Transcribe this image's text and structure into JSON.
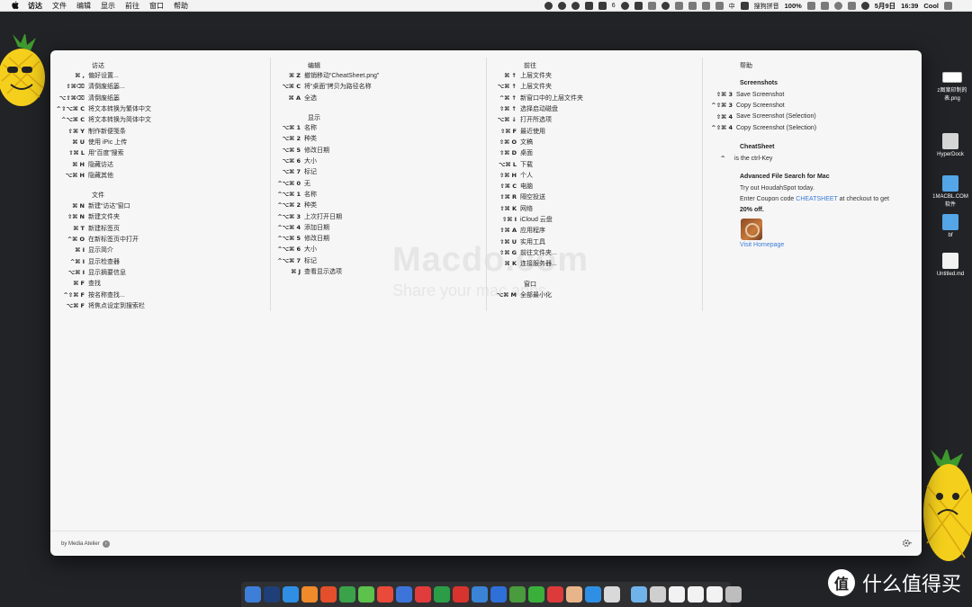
{
  "menubar": {
    "apple_icon": "apple-icon",
    "items": [
      "访达",
      "文件",
      "编辑",
      "显示",
      "前往",
      "窗口",
      "帮助"
    ],
    "status": {
      "battery_percent": "100%",
      "input_method": "搜狗拼音",
      "language": "中",
      "date": "5月9日",
      "time": "16:39",
      "user": "Cool",
      "badge_count": "6"
    }
  },
  "finder": {
    "title": "访达",
    "rows": [
      {
        "key": "⌘ ,",
        "label": "偏好设置..."
      },
      {
        "key": "⇧⌘⌫",
        "label": "清倒废纸篓..."
      },
      {
        "key": "⌥⇧⌘⌫",
        "label": "清倒废纸篓"
      },
      {
        "key": "^⇧⌥⌘ C",
        "label": "将文本转换为繁体中文"
      },
      {
        "key": "^⌥⌘ C",
        "label": "将文本转换为简体中文"
      },
      {
        "key": "⇧⌘ Y",
        "label": "制作新便笺条"
      },
      {
        "key": "⌘ U",
        "label": "使用 iPic 上传"
      },
      {
        "key": "⇧⌘ L",
        "label": "用“百度”搜索"
      },
      {
        "key": "⌘ H",
        "label": "隐藏访达"
      },
      {
        "key": "⌥⌘ H",
        "label": "隐藏其他"
      }
    ]
  },
  "file": {
    "title": "文件",
    "rows": [
      {
        "key": "⌘ N",
        "label": "新建“访达”窗口"
      },
      {
        "key": "⇧⌘ N",
        "label": "新建文件夹"
      },
      {
        "key": "⌘ T",
        "label": "新建标签页"
      },
      {
        "key": "^⌘ O",
        "label": "在新标签页中打开"
      },
      {
        "key": "⌘ I",
        "label": "显示简介"
      },
      {
        "key": "^⌘ I",
        "label": "显示检查器"
      },
      {
        "key": "⌥⌘ I",
        "label": "显示摘要信息"
      },
      {
        "key": "⌘ F",
        "label": "查找"
      },
      {
        "key": "^⇧⌘ F",
        "label": "按名称查找..."
      },
      {
        "key": "⌥⌘ F",
        "label": "将焦点设定到搜索栏"
      }
    ]
  },
  "edit": {
    "title": "编辑",
    "rows": [
      {
        "key": "⌘ Z",
        "label": "撤销移动“CheatSheet.png”"
      },
      {
        "key": "⌥⌘ C",
        "label": "将“桌面”拷贝为路径名称"
      },
      {
        "key": "⌘ A",
        "label": "全选"
      }
    ]
  },
  "view": {
    "title": "显示",
    "rows": [
      {
        "key": "⌥⌘ 1",
        "label": "名称"
      },
      {
        "key": "⌥⌘ 2",
        "label": "种类"
      },
      {
        "key": "⌥⌘ 5",
        "label": "修改日期"
      },
      {
        "key": "⌥⌘ 6",
        "label": "大小"
      },
      {
        "key": "⌥⌘ 7",
        "label": "标记"
      },
      {
        "key": "^⌥⌘ 0",
        "label": "无"
      },
      {
        "key": "^⌥⌘ 1",
        "label": "名称"
      },
      {
        "key": "^⌥⌘ 2",
        "label": "种类"
      },
      {
        "key": "^⌥⌘ 3",
        "label": "上次打开日期"
      },
      {
        "key": "^⌥⌘ 4",
        "label": "添加日期"
      },
      {
        "key": "^⌥⌘ 5",
        "label": "修改日期"
      },
      {
        "key": "^⌥⌘ 6",
        "label": "大小"
      },
      {
        "key": "^⌥⌘ 7",
        "label": "标记"
      },
      {
        "key": "⌘ J",
        "label": "查看显示选项"
      }
    ]
  },
  "go": {
    "title": "前往",
    "rows": [
      {
        "key": "⌘ ↑",
        "label": "上层文件夹"
      },
      {
        "key": "⌥⌘ ↑",
        "label": "上层文件夹"
      },
      {
        "key": "^⌘ ↑",
        "label": "新窗口中的上层文件夹"
      },
      {
        "key": "⇧⌘ ↑",
        "label": "选择启动磁盘"
      },
      {
        "key": "⌥⌘ ↓",
        "label": "打开所选项"
      },
      {
        "key": "⇧⌘ F",
        "label": "最近使用"
      },
      {
        "key": "⇧⌘ O",
        "label": "文稿"
      },
      {
        "key": "⇧⌘ D",
        "label": "桌面"
      },
      {
        "key": "⌥⌘ L",
        "label": "下载"
      },
      {
        "key": "⇧⌘ H",
        "label": "个人"
      },
      {
        "key": "⇧⌘ C",
        "label": "电脑"
      },
      {
        "key": "⇧⌘ R",
        "label": "隔空投送"
      },
      {
        "key": "⇧⌘ K",
        "label": "网络"
      },
      {
        "key": "⇧⌘ I",
        "label": "iCloud 云盘"
      },
      {
        "key": "⇧⌘ A",
        "label": "应用程序"
      },
      {
        "key": "⇧⌘ U",
        "label": "实用工具"
      },
      {
        "key": "⇧⌘ G",
        "label": "前往文件夹..."
      },
      {
        "key": "⌘ K",
        "label": "连接服务器..."
      }
    ]
  },
  "window": {
    "title": "窗口",
    "rows": [
      {
        "key": "⌥⌘ M",
        "label": "全部最小化"
      }
    ]
  },
  "help": {
    "title": "帮助",
    "screenshots_title": "Screenshots",
    "rows": [
      {
        "key": "⇧⌘ 3",
        "label": "Save Screenshot"
      },
      {
        "key": "^⇧⌘ 3",
        "label": "Copy Screenshot"
      },
      {
        "key": "⇧⌘ 4",
        "label": "Save Screenshot (Selection)"
      },
      {
        "key": "^⇧⌘ 4",
        "label": "Copy Screenshot (Selection)"
      }
    ],
    "cheatsheet_title": "CheatSheet",
    "cheatsheet_key": "^",
    "cheatsheet_text": "is the ctrl-Key",
    "promo_title": "Advanced File Search for Mac",
    "promo_line1": "Try out HoudahSpot today.",
    "promo_line2_a": "Enter Coupon code",
    "promo_code": "CHEATSHEET",
    "promo_line2_b": "at checkout to get",
    "promo_line3": "20% off.",
    "visit_link": "Visit Homepage"
  },
  "footer": {
    "by_text": "by Media Atelier"
  },
  "watermark": {
    "line1": "Macdo.com",
    "line2": "Share your mac apps"
  },
  "desktop": [
    {
      "name": "z图案印制的表.png",
      "kind": "png"
    },
    {
      "name": "HyperDock",
      "kind": "drive"
    },
    {
      "name": "1MACBL.COM软件",
      "kind": "folder"
    },
    {
      "name": "bf",
      "kind": "folder"
    },
    {
      "name": "Untitled.md",
      "kind": "doc"
    }
  ],
  "smzdm": {
    "logo_char": "值",
    "text": "什么值得买"
  },
  "colors": {
    "desktop_bg": "#222326",
    "panel_bg": "#f6f6f6",
    "link": "#3b7dd8"
  }
}
